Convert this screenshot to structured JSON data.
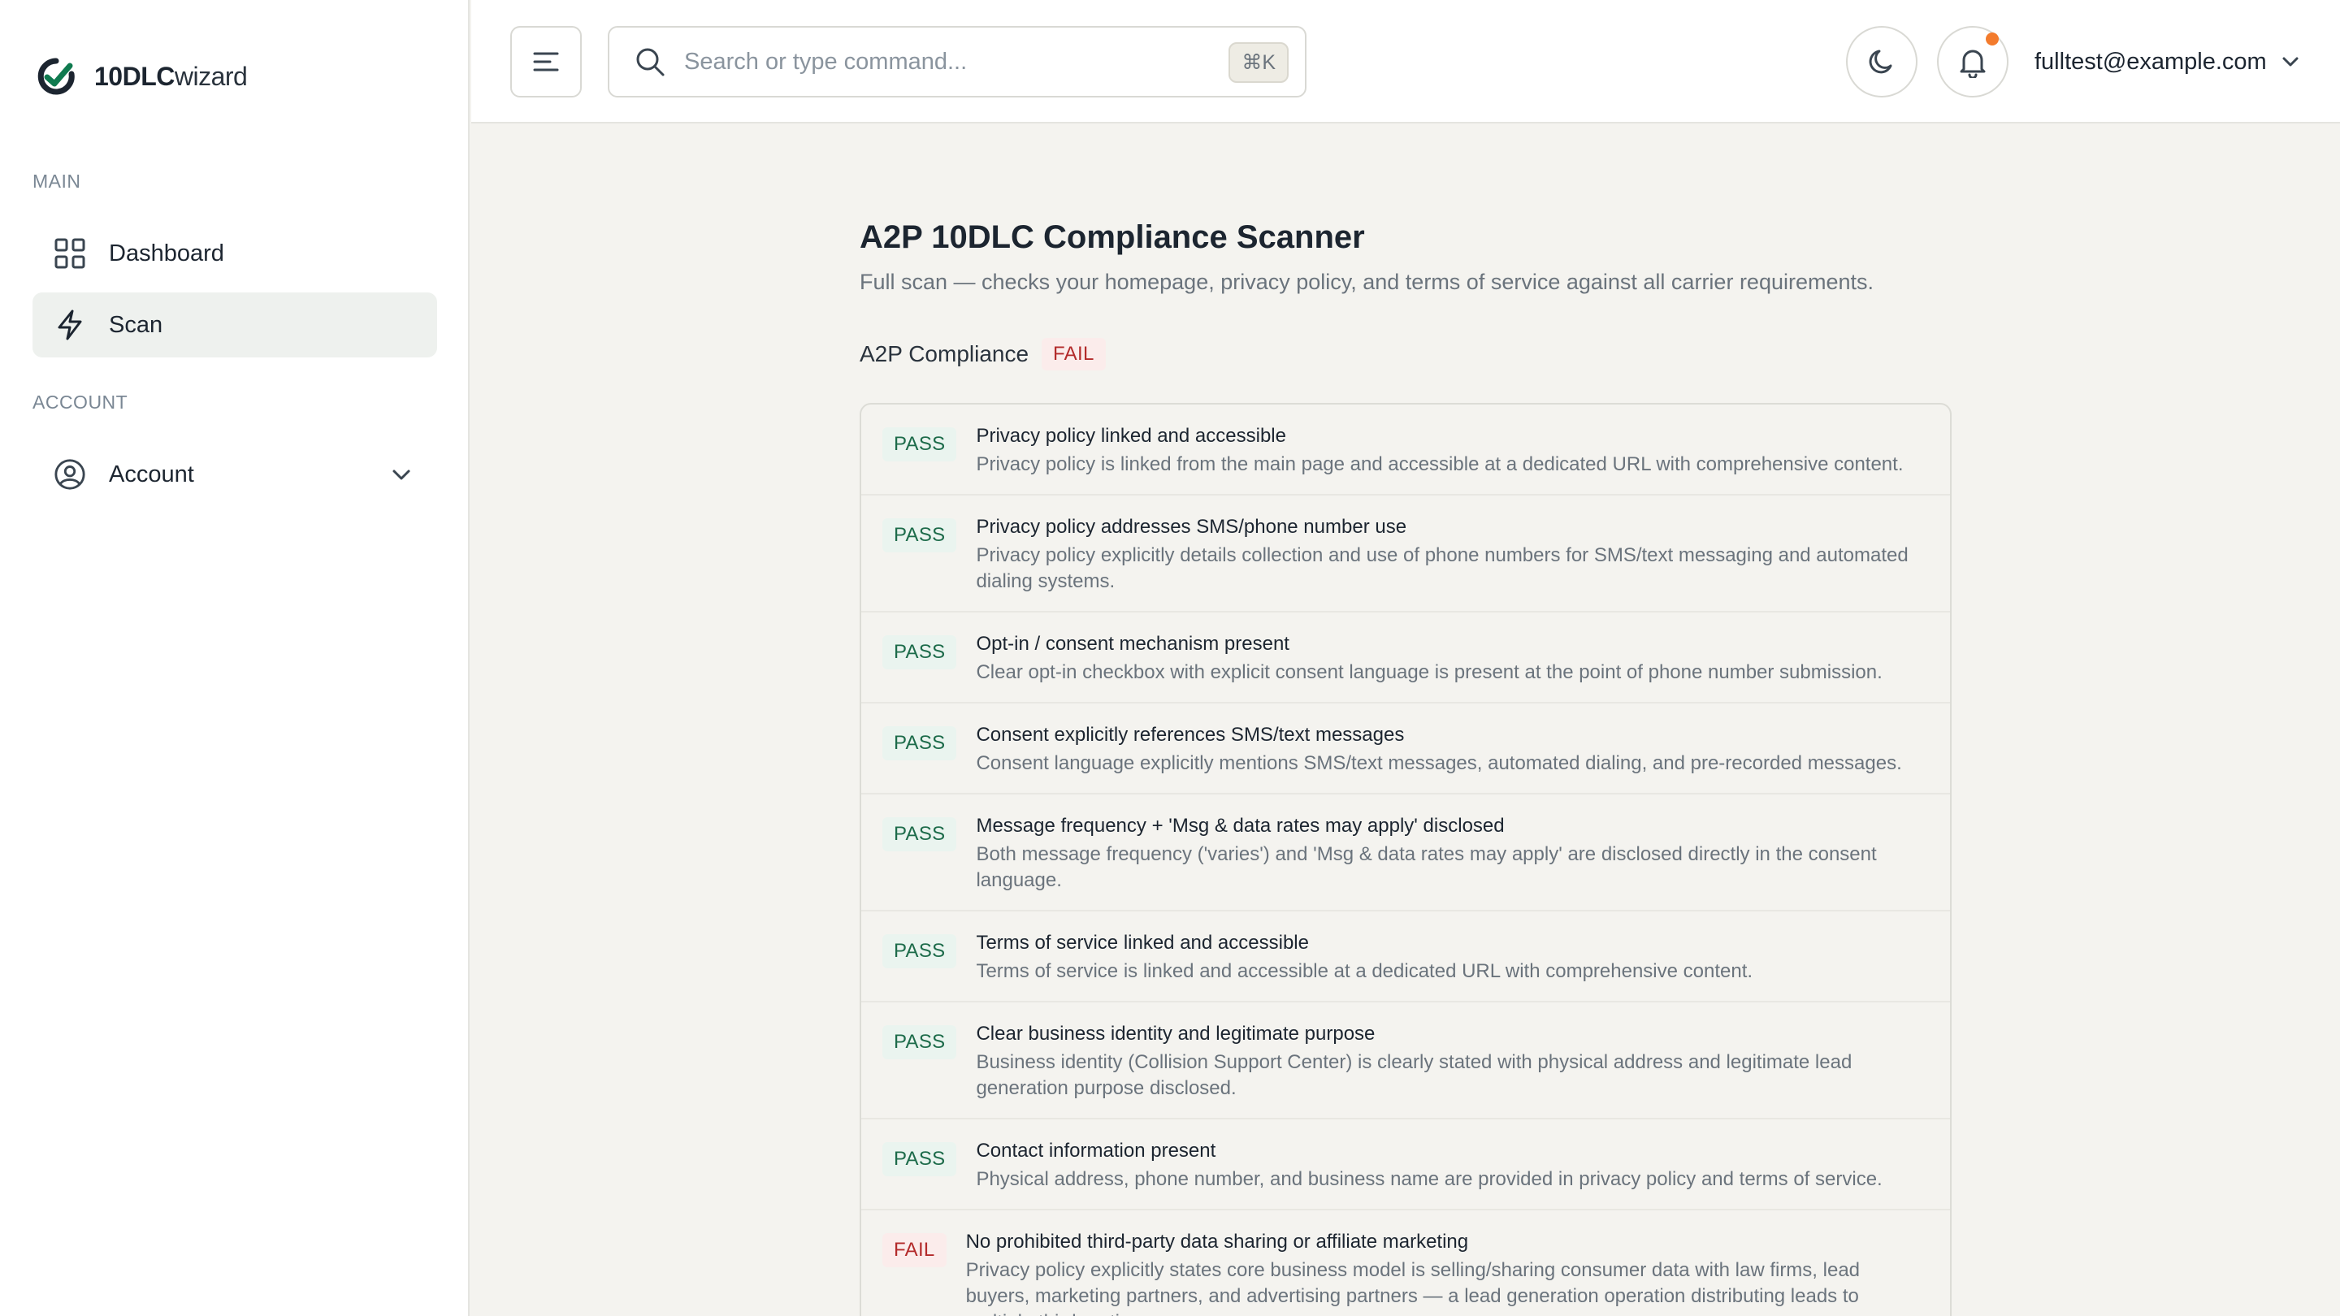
{
  "app": {
    "brand_bold": "10DLC",
    "brand_light": "wizard"
  },
  "sidebar": {
    "main_label": "MAIN",
    "account_label": "ACCOUNT",
    "items": [
      {
        "label": "Dashboard",
        "icon": "grid-icon",
        "active": false
      },
      {
        "label": "Scan",
        "icon": "bolt-icon",
        "active": true
      },
      {
        "label": "Account",
        "icon": "user-circle-icon",
        "active": false,
        "expandable": true
      }
    ]
  },
  "header": {
    "search_placeholder": "Search or type command...",
    "search_shortcut": "⌘K",
    "user_email": "fulltest@example.com",
    "notification_dot_color": "#f37b2d"
  },
  "main": {
    "title": "A2P 10DLC Compliance Scanner",
    "subtitle": "Full scan — checks your homepage, privacy policy, and terms of service against all carrier requirements.",
    "summary_label": "A2P Compliance",
    "summary_status": "FAIL",
    "checks": [
      {
        "status": "PASS",
        "title": "Privacy policy linked and accessible",
        "desc": "Privacy policy is linked from the main page and accessible at a dedicated URL with comprehensive content."
      },
      {
        "status": "PASS",
        "title": "Privacy policy addresses SMS/phone number use",
        "desc": "Privacy policy explicitly details collection and use of phone numbers for SMS/text messaging and automated dialing systems."
      },
      {
        "status": "PASS",
        "title": "Opt-in / consent mechanism present",
        "desc": "Clear opt-in checkbox with explicit consent language is present at the point of phone number submission."
      },
      {
        "status": "PASS",
        "title": "Consent explicitly references SMS/text messages",
        "desc": "Consent language explicitly mentions SMS/text messages, automated dialing, and pre-recorded messages."
      },
      {
        "status": "PASS",
        "title": "Message frequency + 'Msg & data rates may apply' disclosed",
        "desc": "Both message frequency ('varies') and 'Msg & data rates may apply' are disclosed directly in the consent language."
      },
      {
        "status": "PASS",
        "title": "Terms of service linked and accessible",
        "desc": "Terms of service is linked and accessible at a dedicated URL with comprehensive content."
      },
      {
        "status": "PASS",
        "title": "Clear business identity and legitimate purpose",
        "desc": "Business identity (Collision Support Center) is clearly stated with physical address and legitimate lead generation purpose disclosed."
      },
      {
        "status": "PASS",
        "title": "Contact information present",
        "desc": "Physical address, phone number, and business name are provided in privacy policy and terms of service."
      },
      {
        "status": "FAIL",
        "title": "No prohibited third-party data sharing or affiliate marketing",
        "desc": "Privacy policy explicitly states core business model is selling/sharing consumer data with law firms, lead buyers, marketing partners, and advertising partners — a lead generation operation distributing leads to multiple third parties."
      }
    ]
  },
  "colors": {
    "pass": "#1d6b4a",
    "pass_bg": "#eaf4ef",
    "fail": "#b32b2b",
    "fail_bg": "#fbeceb",
    "brand_green": "#0f7a4f"
  }
}
